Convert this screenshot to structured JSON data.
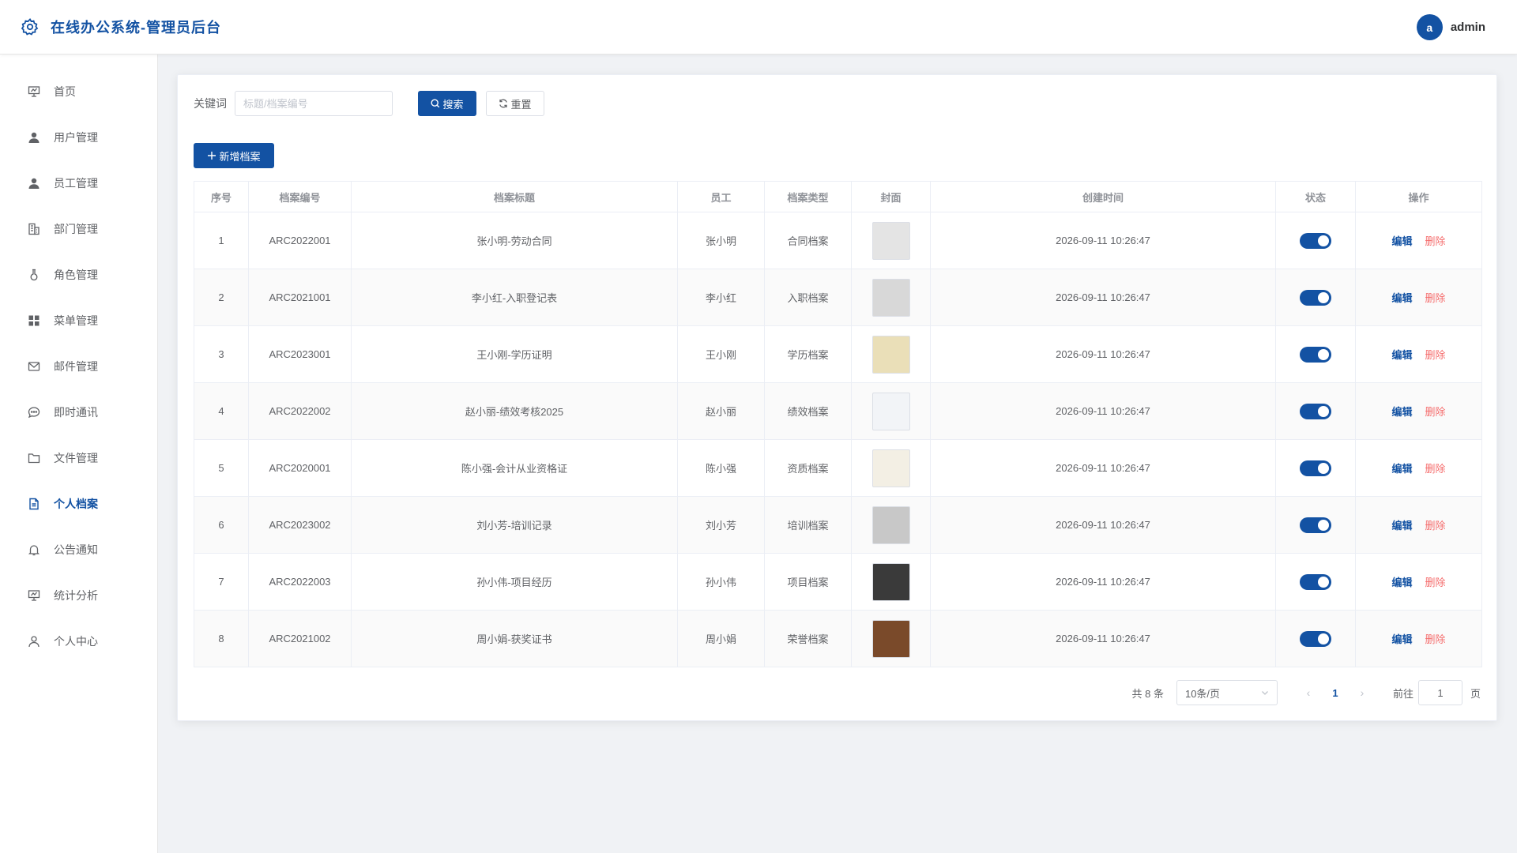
{
  "header": {
    "title": "在线办公系统-管理员后台",
    "avatar_letter": "a",
    "username": "admin",
    "icon": "gear-icon"
  },
  "sidebar": {
    "items": [
      {
        "label": "首页",
        "icon": "presentation-icon",
        "active": false
      },
      {
        "label": "用户管理",
        "icon": "user-icon",
        "active": false
      },
      {
        "label": "员工管理",
        "icon": "user-icon",
        "active": false
      },
      {
        "label": "部门管理",
        "icon": "building-icon",
        "active": false
      },
      {
        "label": "角色管理",
        "icon": "flask-icon",
        "active": false
      },
      {
        "label": "菜单管理",
        "icon": "grid-icon",
        "active": false
      },
      {
        "label": "邮件管理",
        "icon": "mail-icon",
        "active": false
      },
      {
        "label": "即时通讯",
        "icon": "chat-icon",
        "active": false
      },
      {
        "label": "文件管理",
        "icon": "folder-icon",
        "active": false
      },
      {
        "label": "个人档案",
        "icon": "document-icon",
        "active": true
      },
      {
        "label": "公告通知",
        "icon": "bell-icon",
        "active": false
      },
      {
        "label": "统计分析",
        "icon": "presentation-icon",
        "active": false
      },
      {
        "label": "个人中心",
        "icon": "person-icon",
        "active": false
      }
    ]
  },
  "search": {
    "label": "关键词",
    "placeholder": "标题/档案编号",
    "value": "",
    "search_label": "搜索",
    "reset_label": "重置"
  },
  "toolbar": {
    "add_label": "新增档案"
  },
  "table": {
    "columns": [
      "序号",
      "档案编号",
      "档案标题",
      "员工",
      "档案类型",
      "封面",
      "创建时间",
      "状态",
      "操作"
    ],
    "edit_label": "编辑",
    "delete_label": "删除",
    "rows": [
      {
        "index": "1",
        "code": "ARC2022001",
        "title": "张小明-劳动合同",
        "employee": "张小明",
        "type": "合同档案",
        "created": "2026-09-11 10:26:47",
        "enabled": true,
        "cover_color": "#e4e4e4"
      },
      {
        "index": "2",
        "code": "ARC2021001",
        "title": "李小红-入职登记表",
        "employee": "李小红",
        "type": "入职档案",
        "created": "2026-09-11 10:26:47",
        "enabled": true,
        "cover_color": "#d8d8d8"
      },
      {
        "index": "3",
        "code": "ARC2023001",
        "title": "王小刚-学历证明",
        "employee": "王小刚",
        "type": "学历档案",
        "created": "2026-09-11 10:26:47",
        "enabled": true,
        "cover_color": "#eadfb8"
      },
      {
        "index": "4",
        "code": "ARC2022002",
        "title": "赵小丽-绩效考核2025",
        "employee": "赵小丽",
        "type": "绩效档案",
        "created": "2026-09-11 10:26:47",
        "enabled": true,
        "cover_color": "#f2f4f7"
      },
      {
        "index": "5",
        "code": "ARC2020001",
        "title": "陈小强-会计从业资格证",
        "employee": "陈小强",
        "type": "资质档案",
        "created": "2026-09-11 10:26:47",
        "enabled": true,
        "cover_color": "#f3efe4"
      },
      {
        "index": "6",
        "code": "ARC2023002",
        "title": "刘小芳-培训记录",
        "employee": "刘小芳",
        "type": "培训档案",
        "created": "2026-09-11 10:26:47",
        "enabled": true,
        "cover_color": "#c8c8c8"
      },
      {
        "index": "7",
        "code": "ARC2022003",
        "title": "孙小伟-项目经历",
        "employee": "孙小伟",
        "type": "项目档案",
        "created": "2026-09-11 10:26:47",
        "enabled": true,
        "cover_color": "#3a3a3a"
      },
      {
        "index": "8",
        "code": "ARC2021002",
        "title": "周小娟-获奖证书",
        "employee": "周小娟",
        "type": "荣誉档案",
        "created": "2026-09-11 10:26:47",
        "enabled": true,
        "cover_color": "#7a4a2a"
      }
    ]
  },
  "pagination": {
    "total_text": "共 8 条",
    "page_size": "10条/页",
    "current_page": "1",
    "goto_label": "前往",
    "goto_value": "1",
    "goto_suffix": "页"
  },
  "colors": {
    "primary": "#1352a3",
    "danger": "#f56c6c"
  }
}
